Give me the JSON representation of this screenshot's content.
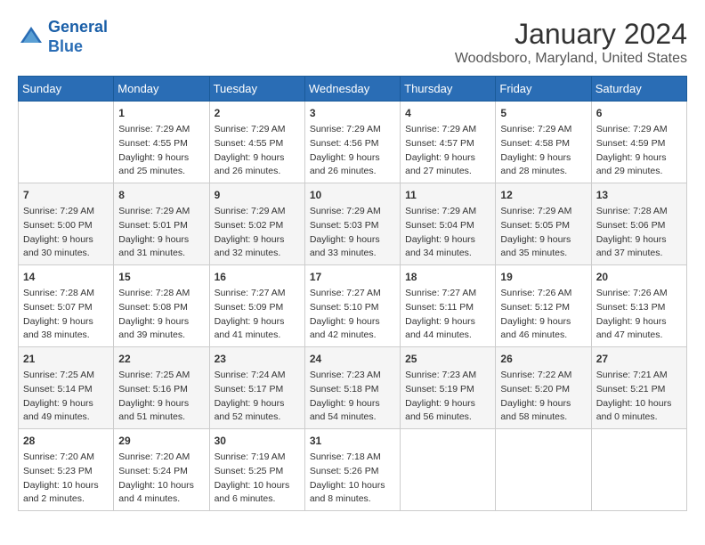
{
  "logo": {
    "line1": "General",
    "line2": "Blue"
  },
  "title": "January 2024",
  "subtitle": "Woodsboro, Maryland, United States",
  "headers": [
    "Sunday",
    "Monday",
    "Tuesday",
    "Wednesday",
    "Thursday",
    "Friday",
    "Saturday"
  ],
  "weeks": [
    [
      {
        "day": "",
        "sunrise": "",
        "sunset": "",
        "daylight": ""
      },
      {
        "day": "1",
        "sunrise": "Sunrise: 7:29 AM",
        "sunset": "Sunset: 4:55 PM",
        "daylight": "Daylight: 9 hours and 25 minutes."
      },
      {
        "day": "2",
        "sunrise": "Sunrise: 7:29 AM",
        "sunset": "Sunset: 4:55 PM",
        "daylight": "Daylight: 9 hours and 26 minutes."
      },
      {
        "day": "3",
        "sunrise": "Sunrise: 7:29 AM",
        "sunset": "Sunset: 4:56 PM",
        "daylight": "Daylight: 9 hours and 26 minutes."
      },
      {
        "day": "4",
        "sunrise": "Sunrise: 7:29 AM",
        "sunset": "Sunset: 4:57 PM",
        "daylight": "Daylight: 9 hours and 27 minutes."
      },
      {
        "day": "5",
        "sunrise": "Sunrise: 7:29 AM",
        "sunset": "Sunset: 4:58 PM",
        "daylight": "Daylight: 9 hours and 28 minutes."
      },
      {
        "day": "6",
        "sunrise": "Sunrise: 7:29 AM",
        "sunset": "Sunset: 4:59 PM",
        "daylight": "Daylight: 9 hours and 29 minutes."
      }
    ],
    [
      {
        "day": "7",
        "sunrise": "Sunrise: 7:29 AM",
        "sunset": "Sunset: 5:00 PM",
        "daylight": "Daylight: 9 hours and 30 minutes."
      },
      {
        "day": "8",
        "sunrise": "Sunrise: 7:29 AM",
        "sunset": "Sunset: 5:01 PM",
        "daylight": "Daylight: 9 hours and 31 minutes."
      },
      {
        "day": "9",
        "sunrise": "Sunrise: 7:29 AM",
        "sunset": "Sunset: 5:02 PM",
        "daylight": "Daylight: 9 hours and 32 minutes."
      },
      {
        "day": "10",
        "sunrise": "Sunrise: 7:29 AM",
        "sunset": "Sunset: 5:03 PM",
        "daylight": "Daylight: 9 hours and 33 minutes."
      },
      {
        "day": "11",
        "sunrise": "Sunrise: 7:29 AM",
        "sunset": "Sunset: 5:04 PM",
        "daylight": "Daylight: 9 hours and 34 minutes."
      },
      {
        "day": "12",
        "sunrise": "Sunrise: 7:29 AM",
        "sunset": "Sunset: 5:05 PM",
        "daylight": "Daylight: 9 hours and 35 minutes."
      },
      {
        "day": "13",
        "sunrise": "Sunrise: 7:28 AM",
        "sunset": "Sunset: 5:06 PM",
        "daylight": "Daylight: 9 hours and 37 minutes."
      }
    ],
    [
      {
        "day": "14",
        "sunrise": "Sunrise: 7:28 AM",
        "sunset": "Sunset: 5:07 PM",
        "daylight": "Daylight: 9 hours and 38 minutes."
      },
      {
        "day": "15",
        "sunrise": "Sunrise: 7:28 AM",
        "sunset": "Sunset: 5:08 PM",
        "daylight": "Daylight: 9 hours and 39 minutes."
      },
      {
        "day": "16",
        "sunrise": "Sunrise: 7:27 AM",
        "sunset": "Sunset: 5:09 PM",
        "daylight": "Daylight: 9 hours and 41 minutes."
      },
      {
        "day": "17",
        "sunrise": "Sunrise: 7:27 AM",
        "sunset": "Sunset: 5:10 PM",
        "daylight": "Daylight: 9 hours and 42 minutes."
      },
      {
        "day": "18",
        "sunrise": "Sunrise: 7:27 AM",
        "sunset": "Sunset: 5:11 PM",
        "daylight": "Daylight: 9 hours and 44 minutes."
      },
      {
        "day": "19",
        "sunrise": "Sunrise: 7:26 AM",
        "sunset": "Sunset: 5:12 PM",
        "daylight": "Daylight: 9 hours and 46 minutes."
      },
      {
        "day": "20",
        "sunrise": "Sunrise: 7:26 AM",
        "sunset": "Sunset: 5:13 PM",
        "daylight": "Daylight: 9 hours and 47 minutes."
      }
    ],
    [
      {
        "day": "21",
        "sunrise": "Sunrise: 7:25 AM",
        "sunset": "Sunset: 5:14 PM",
        "daylight": "Daylight: 9 hours and 49 minutes."
      },
      {
        "day": "22",
        "sunrise": "Sunrise: 7:25 AM",
        "sunset": "Sunset: 5:16 PM",
        "daylight": "Daylight: 9 hours and 51 minutes."
      },
      {
        "day": "23",
        "sunrise": "Sunrise: 7:24 AM",
        "sunset": "Sunset: 5:17 PM",
        "daylight": "Daylight: 9 hours and 52 minutes."
      },
      {
        "day": "24",
        "sunrise": "Sunrise: 7:23 AM",
        "sunset": "Sunset: 5:18 PM",
        "daylight": "Daylight: 9 hours and 54 minutes."
      },
      {
        "day": "25",
        "sunrise": "Sunrise: 7:23 AM",
        "sunset": "Sunset: 5:19 PM",
        "daylight": "Daylight: 9 hours and 56 minutes."
      },
      {
        "day": "26",
        "sunrise": "Sunrise: 7:22 AM",
        "sunset": "Sunset: 5:20 PM",
        "daylight": "Daylight: 9 hours and 58 minutes."
      },
      {
        "day": "27",
        "sunrise": "Sunrise: 7:21 AM",
        "sunset": "Sunset: 5:21 PM",
        "daylight": "Daylight: 10 hours and 0 minutes."
      }
    ],
    [
      {
        "day": "28",
        "sunrise": "Sunrise: 7:20 AM",
        "sunset": "Sunset: 5:23 PM",
        "daylight": "Daylight: 10 hours and 2 minutes."
      },
      {
        "day": "29",
        "sunrise": "Sunrise: 7:20 AM",
        "sunset": "Sunset: 5:24 PM",
        "daylight": "Daylight: 10 hours and 4 minutes."
      },
      {
        "day": "30",
        "sunrise": "Sunrise: 7:19 AM",
        "sunset": "Sunset: 5:25 PM",
        "daylight": "Daylight: 10 hours and 6 minutes."
      },
      {
        "day": "31",
        "sunrise": "Sunrise: 7:18 AM",
        "sunset": "Sunset: 5:26 PM",
        "daylight": "Daylight: 10 hours and 8 minutes."
      },
      {
        "day": "",
        "sunrise": "",
        "sunset": "",
        "daylight": ""
      },
      {
        "day": "",
        "sunrise": "",
        "sunset": "",
        "daylight": ""
      },
      {
        "day": "",
        "sunrise": "",
        "sunset": "",
        "daylight": ""
      }
    ]
  ]
}
